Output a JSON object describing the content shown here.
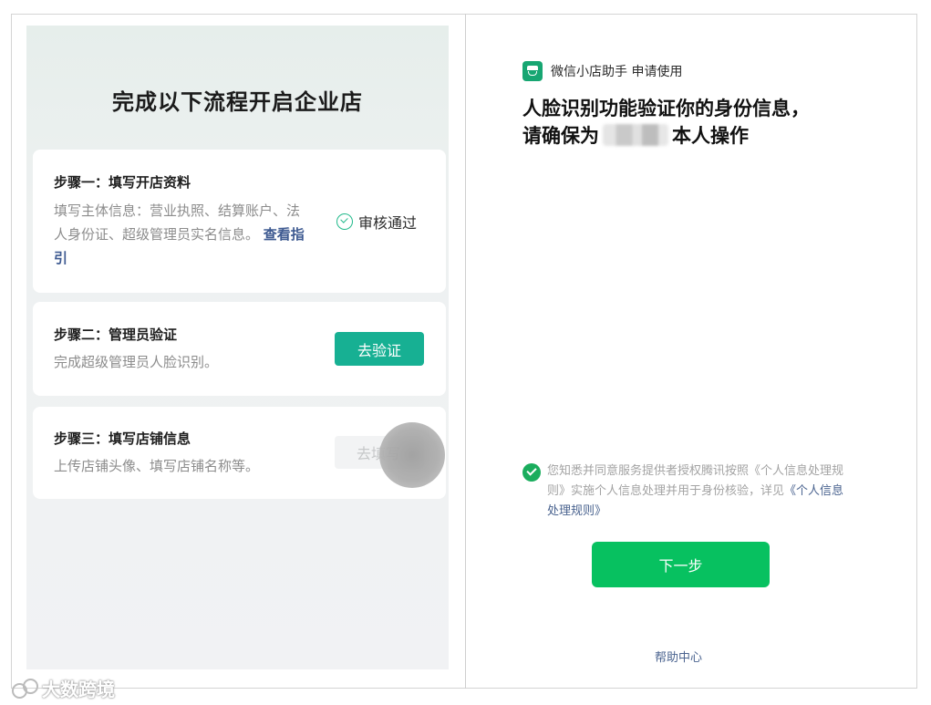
{
  "left": {
    "title": "完成以下流程开启企业店",
    "steps": [
      {
        "title": "步骤一：填写开店资料",
        "desc": "填写主体信息：营业执照、结算账户、法人身份证、超级管理员实名信息。",
        "link": "查看指引",
        "status": "审核通过"
      },
      {
        "title": "步骤二：管理员验证",
        "desc": "完成超级管理员人脸识别。",
        "button": "去验证"
      },
      {
        "title": "步骤三：填写店铺信息",
        "desc": "上传店铺头像、填写店铺名称等。",
        "button": "去填写"
      }
    ]
  },
  "right": {
    "app_name": "微信小店助手 申请使用",
    "headline_line1": "人脸识别功能验证你的身份信息，",
    "headline_prefix": "请确保为",
    "headline_suffix": "本人操作",
    "consent_text": "您知悉并同意服务提供者授权腾讯按照《个人信息处理规则》实施个人信息处理并用于身份核验，详见",
    "consent_link": "《个人信息处理规则》",
    "next_button": "下一步",
    "help": "帮助中心"
  },
  "watermark": "大数跨境",
  "colors": {
    "primary_teal": "#17b093",
    "wechat_green": "#07c160",
    "link_blue": "#4a638f",
    "check_green": "#20b98a"
  }
}
